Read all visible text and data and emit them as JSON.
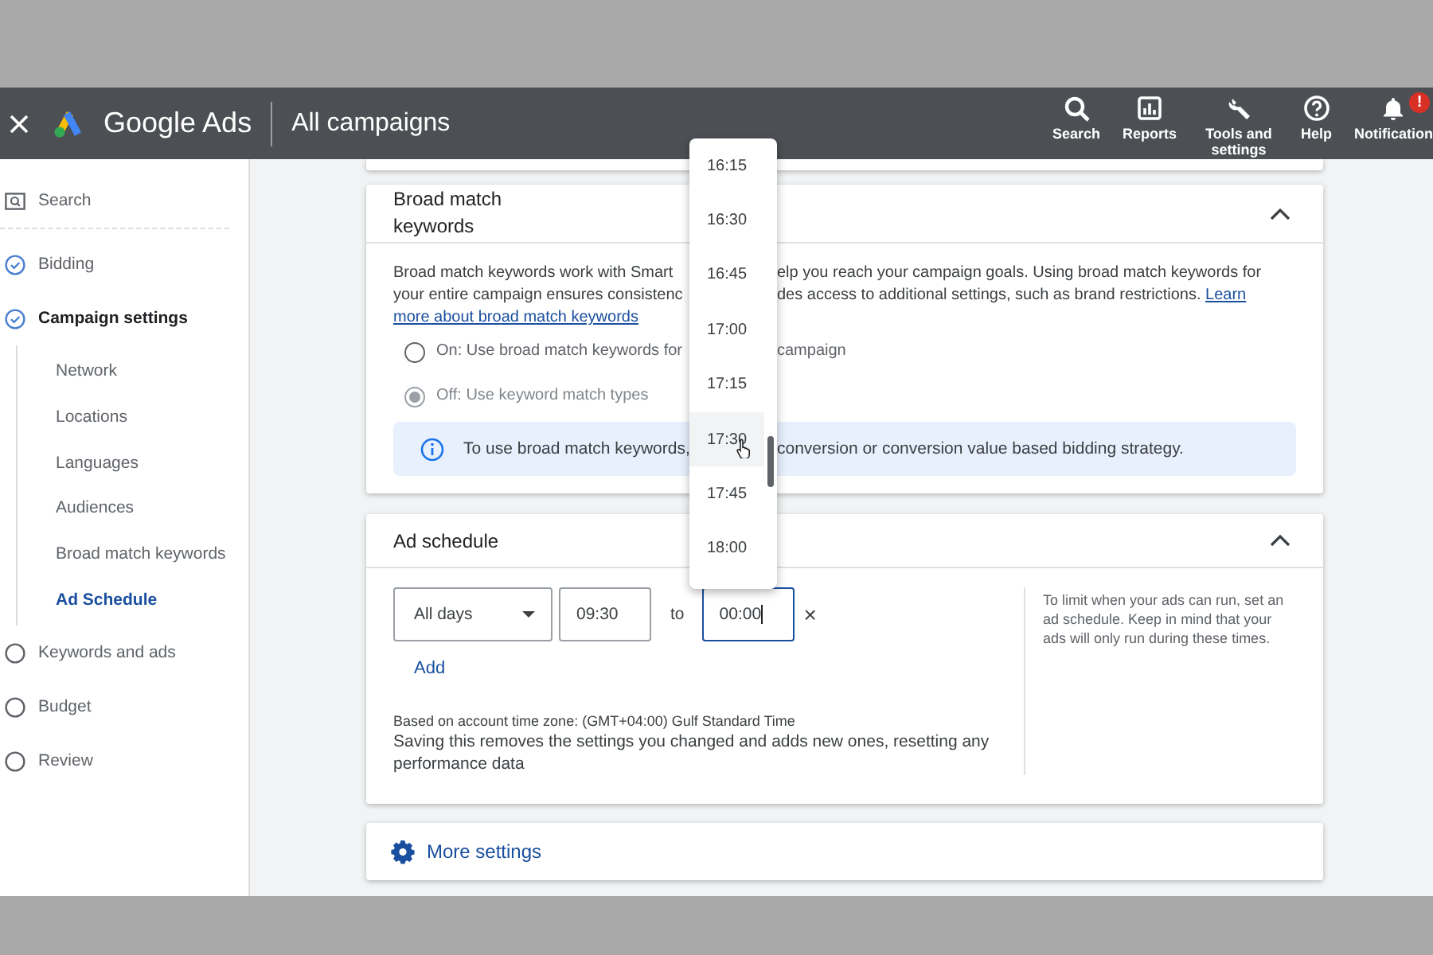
{
  "topbar": {
    "brand": "Google Ads",
    "title": "All campaigns",
    "actions": [
      {
        "kind": "search",
        "label": "Search"
      },
      {
        "kind": "reports",
        "label": "Reports"
      },
      {
        "kind": "tools",
        "label": "Tools and settings"
      },
      {
        "kind": "help",
        "label": "Help"
      },
      {
        "kind": "bell",
        "label": "Notification",
        "badge": "!"
      }
    ]
  },
  "sidebar": {
    "items": [
      {
        "kind": "search",
        "label": "Search",
        "selected": false
      },
      {
        "kind": "done",
        "label": "Bidding",
        "selected": false
      },
      {
        "kind": "done",
        "label": "Campaign settings",
        "selected": true,
        "children": [
          {
            "label": "Network",
            "selected": false
          },
          {
            "label": "Locations",
            "selected": false
          },
          {
            "label": "Languages",
            "selected": false
          },
          {
            "label": "Audiences",
            "selected": false
          },
          {
            "label": "Broad match keywords",
            "selected": false
          },
          {
            "label": "Ad Schedule",
            "selected": true
          }
        ]
      },
      {
        "kind": "todo",
        "label": "Keywords and ads",
        "selected": false
      },
      {
        "kind": "todo",
        "label": "Budget",
        "selected": false
      },
      {
        "kind": "todo",
        "label": "Review",
        "selected": false
      }
    ]
  },
  "broad_match": {
    "title": "Broad match keywords",
    "expanded": true,
    "description": [
      {
        "left": "Broad match keywords work with Smart",
        "right": "elp you reach your campaign goals. Using broad match keywords for"
      },
      {
        "left": "your entire campaign ensures consistenc",
        "right": "des access to additional settings, such as brand restrictions.",
        "link": "Learn"
      },
      {
        "link": "more about broad match keywords"
      }
    ],
    "options": [
      {
        "left": "On: Use broad match keywords for",
        "right": "campaign",
        "selected": false,
        "disabled": false
      },
      {
        "left": "Off: Use keyword match types",
        "selected": true,
        "disabled": true
      }
    ],
    "info": {
      "left": "To use broad match keywords,",
      "right": "conversion or conversion value based bidding strategy."
    }
  },
  "ad_schedule": {
    "title": "Ad schedule",
    "expanded": true,
    "day": "All days",
    "start": "09:30",
    "separator": "to",
    "end": "00:00",
    "end_focused": true,
    "remove": "×",
    "add": "Add",
    "timezone": "Based on account time zone: (GMT+04:00) Gulf Standard Time",
    "warning": "Saving this removes the settings you changed and adds new ones, resetting any performance data",
    "help": "To limit when your ads can run, set an ad schedule. Keep in mind that your ads will only run during these times."
  },
  "more_settings": {
    "label": "More settings"
  },
  "time_menu": {
    "options": [
      {
        "label": "16:15",
        "selected": false
      },
      {
        "label": "16:30",
        "selected": false
      },
      {
        "label": "16:45",
        "selected": false
      },
      {
        "label": "17:00",
        "selected": false
      },
      {
        "label": "17:15",
        "selected": false
      },
      {
        "label": "17:30",
        "selected": true
      },
      {
        "label": "17:45",
        "selected": false
      },
      {
        "label": "18:00",
        "selected": false
      }
    ]
  }
}
